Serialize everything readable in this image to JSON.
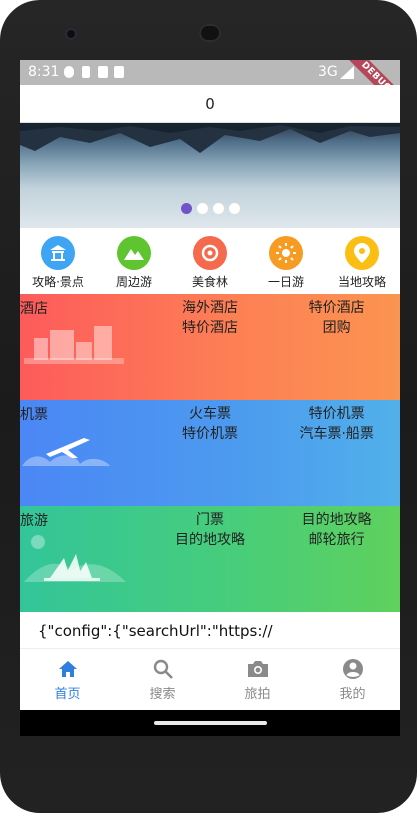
{
  "status_bar": {
    "time": "8:31",
    "network": "3G",
    "debug_banner": "DEBUG"
  },
  "app_bar": {
    "title": "0"
  },
  "banner": {
    "slide_count": 4,
    "active_index": 0,
    "active_color": "#6f55c8"
  },
  "quick_nav": [
    {
      "label": "攻略·景点",
      "icon": "temple-icon",
      "color": "#3da5f3"
    },
    {
      "label": "周边游",
      "icon": "mountain-icon",
      "color": "#5ec531"
    },
    {
      "label": "美食林",
      "icon": "food-icon",
      "color": "#f5694c"
    },
    {
      "label": "一日游",
      "icon": "sun-icon",
      "color": "#f89b22"
    },
    {
      "label": "当地攻略",
      "icon": "location-pin-icon",
      "color": "#fbbf14"
    }
  ],
  "grid_nav": {
    "hotel": {
      "main_label": "酒店",
      "col2": [
        "海外酒店",
        "特价酒店"
      ],
      "col3": [
        "特价酒店",
        "团购"
      ],
      "gradient": [
        "#fd5b5b",
        "#fb9450"
      ]
    },
    "flight": {
      "main_label": "机票",
      "col2": [
        "火车票",
        "特价机票"
      ],
      "col3": [
        "特价机票",
        "汽车票·船票"
      ],
      "gradient": [
        "#4b87f5",
        "#51b0ea"
      ]
    },
    "travel": {
      "main_label": "旅游",
      "col2": [
        "门票",
        "目的地攻略"
      ],
      "col3": [
        "目的地攻略",
        "邮轮旅行"
      ],
      "gradient": [
        "#33c59a",
        "#5fd15d"
      ]
    }
  },
  "config_text": "{\"config\":{\"searchUrl\":\"https://",
  "bottom_nav": [
    {
      "label": "首页",
      "icon": "home-icon",
      "active": true
    },
    {
      "label": "搜索",
      "icon": "search-icon",
      "active": false
    },
    {
      "label": "旅拍",
      "icon": "camera-icon",
      "active": false
    },
    {
      "label": "我的",
      "icon": "account-icon",
      "active": false
    }
  ],
  "colors": {
    "nav_active": "#2f7fe0",
    "nav_inactive": "#8a8a8a"
  }
}
